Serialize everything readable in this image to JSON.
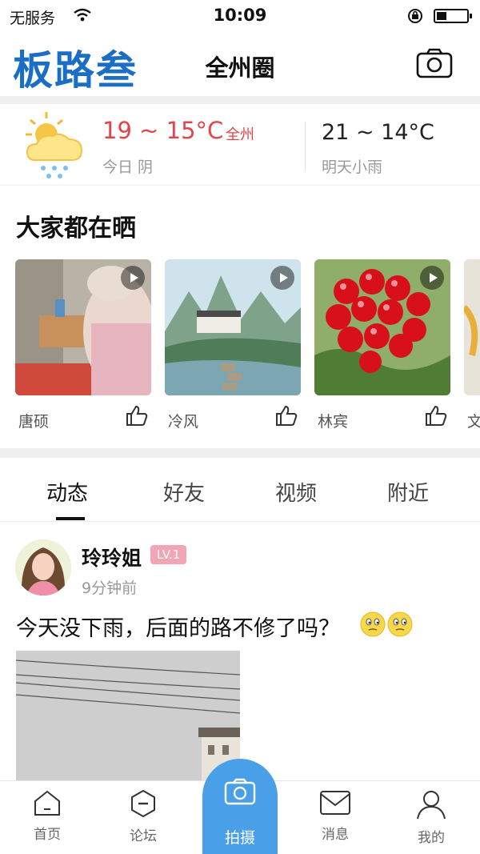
{
  "status_bar": {
    "carrier": "无服务",
    "time": "10:09"
  },
  "header": {
    "logo": "板路叁",
    "title": "全州圈"
  },
  "weather": {
    "today_temp": "19 ~ 15°C",
    "today_area": "全州",
    "today_desc": "今日 阴",
    "tomorrow_temp": "21 ~ 14°C",
    "tomorrow_desc": "明天小雨"
  },
  "share": {
    "title": "大家都在晒",
    "items": [
      {
        "name": "唐硕"
      },
      {
        "name": "冷风"
      },
      {
        "name": "林宾"
      },
      {
        "name": "文"
      }
    ]
  },
  "tabs": [
    {
      "label": "动态",
      "active": true
    },
    {
      "label": "好友",
      "active": false
    },
    {
      "label": "视频",
      "active": false
    },
    {
      "label": "附近",
      "active": false
    }
  ],
  "post": {
    "username": "玲玲姐",
    "level": "LV.1",
    "time_ago": "9分钟前",
    "text": "今天没下雨，后面的路不修了吗？"
  },
  "bottom_nav": {
    "home": "首页",
    "forum": "论坛",
    "shoot": "拍摄",
    "messages": "消息",
    "profile": "我的"
  },
  "colors": {
    "accent": "#4a9fe9",
    "logo": "#1a6fc4",
    "temp_red": "#e0454a"
  }
}
